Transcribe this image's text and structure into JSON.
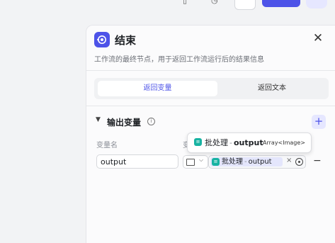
{
  "panel": {
    "title": "结束",
    "description": "工作流的最终节点，用于返回工作流运行后的结果信息",
    "tabs": [
      {
        "label": "返回变量",
        "active": true
      },
      {
        "label": "返回文本",
        "active": false
      }
    ],
    "output_section": {
      "title": "输出变量",
      "columns": {
        "name": "变量名",
        "value": "变"
      },
      "rows": [
        {
          "name": "output",
          "type_icon": "image-icon",
          "reference": {
            "node": "批处理",
            "separator": "-",
            "field": "output"
          }
        }
      ]
    },
    "tooltip": {
      "node": "批处理",
      "separator": "-",
      "field": "output",
      "type": "Array<Image>"
    }
  },
  "colors": {
    "accent": "#4d53e8",
    "node_icon": "#18b3a2",
    "chip_bg": "#e4e6fc"
  }
}
